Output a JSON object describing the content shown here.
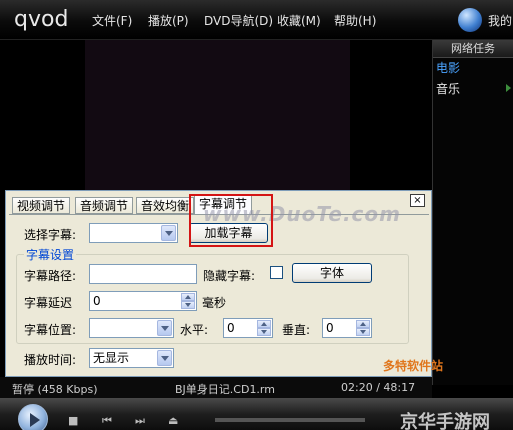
{
  "app": {
    "logo": "qvod",
    "menu": [
      "文件(F)",
      "播放(P)",
      "DVD导航(D)",
      "收藏(M)",
      "帮助(H)"
    ],
    "user": "我的"
  },
  "side_panel": {
    "title": "网络任务",
    "items": [
      {
        "label": "电影",
        "active": true
      },
      {
        "label": "音乐",
        "active": false
      }
    ]
  },
  "dialog": {
    "tabs": [
      "视频调节",
      "音频调节",
      "音效均衡",
      "字幕调节"
    ],
    "active_tab": "字幕调节",
    "watermark": "www.DuoTe.com",
    "close": "×",
    "select_subtitle_label": "选择字幕:",
    "select_subtitle_value": "",
    "load_subtitle_button": "加载字幕",
    "group_title": "字幕设置",
    "path_label": "字幕路径:",
    "path_value": "",
    "hide_label": "隐藏字幕:",
    "hide_checked": false,
    "font_button": "字体",
    "delay_label": "字幕延迟",
    "delay_value": "0",
    "delay_unit": "毫秒",
    "position_label": "字幕位置:",
    "position_value": "",
    "horizontal_label": "水平:",
    "horizontal_value": "0",
    "vertical_label": "垂直:",
    "vertical_value": "0",
    "playtime_label": "播放时间:",
    "playtime_value": "无显示"
  },
  "status": {
    "state": "暂停 (458 Kbps)",
    "file": "BJ单身日记.CD1.rm",
    "time": "02:20 / 48:17"
  },
  "watermarks": {
    "duote_site": "多特软件站",
    "corner": "京华手游网"
  },
  "colors": {
    "highlight_box": "#d41414",
    "active_side_item": "#4aa3ff",
    "group_title": "#0046d5"
  }
}
